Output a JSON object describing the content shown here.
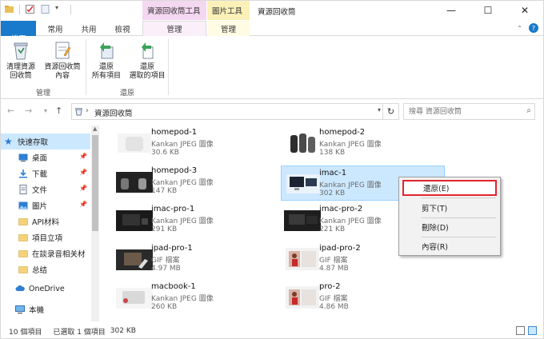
{
  "title_bar": {
    "context_tab_recycle": "資源回收筒工具",
    "context_tab_picture": "圖片工具",
    "window_title": "資源回收筒",
    "minimize": "—",
    "maximize": "☐",
    "close": "✕"
  },
  "tabs": {
    "file": "檔案",
    "home": "常用",
    "share": "共用",
    "view": "檢視",
    "manage1": "管理",
    "manage2": "管理"
  },
  "ribbon": {
    "btn_empty": "清理資源\n回收筒",
    "btn_properties": "資源回收筒\n內容",
    "group_manage": "管理",
    "btn_restore_all": "還原\n所有項目",
    "btn_restore_selected": "還原\n選取的項目",
    "group_restore": "還原"
  },
  "address": {
    "location": "資源回收筒",
    "search_placeholder": "搜尋 資源回收筒"
  },
  "nav_pane": {
    "items": [
      {
        "label": "快速存取",
        "icon": "star-icon"
      },
      {
        "label": "桌面",
        "icon": "desktop-icon"
      },
      {
        "label": "下載",
        "icon": "download-icon"
      },
      {
        "label": "文件",
        "icon": "document-icon"
      },
      {
        "label": "圖片",
        "icon": "pictures-icon"
      },
      {
        "label": "API材料",
        "icon": "folder-icon"
      },
      {
        "label": "項目立項",
        "icon": "folder-icon"
      },
      {
        "label": "在談录音相关材",
        "icon": "folder-icon"
      },
      {
        "label": "总结",
        "icon": "folder-icon"
      },
      {
        "label": "OneDrive",
        "icon": "cloud-icon"
      },
      {
        "label": "本機",
        "icon": "computer-icon"
      }
    ],
    "pin": "📌"
  },
  "files": [
    {
      "name": "homepod-1",
      "type": "Kankan JPEG 圖像",
      "size": "30.6 KB"
    },
    {
      "name": "homepod-2",
      "type": "Kankan JPEG 圖像",
      "size": "138 KB"
    },
    {
      "name": "homepod-3",
      "type": "Kankan JPEG 圖像",
      "size": "147 KB"
    },
    {
      "name": "imac-1",
      "type": "Kankan JPEG 圖像",
      "size": "302 KB"
    },
    {
      "name": "imac-pro-1",
      "type": "Kankan JPEG 圖像",
      "size": "291 KB"
    },
    {
      "name": "imac-pro-2",
      "type": "Kankan JPEG 圖像",
      "size": "221 KB"
    },
    {
      "name": "ipad-pro-1",
      "type": "GIF 檔案",
      "size": "4.97 MB"
    },
    {
      "name": "ipad-pro-2",
      "type": "GIF 檔案",
      "size": "4.87 MB"
    },
    {
      "name": "macbook-1",
      "type": "Kankan JPEG 圖像",
      "size": "260 KB"
    },
    {
      "name": "pro-2",
      "type": "GIF 檔案",
      "size": "4.86 MB"
    }
  ],
  "context_menu": {
    "restore": "還原(E)",
    "cut": "剪下(T)",
    "delete": "刪除(D)",
    "properties": "內容(R)"
  },
  "status": {
    "count": "10 個項目",
    "selected": "已選取 1 個項目",
    "size": "302 KB"
  },
  "colors": {
    "accent": "#1979ca",
    "selection": "#cce8ff",
    "highlight_border": "#e0262d"
  }
}
